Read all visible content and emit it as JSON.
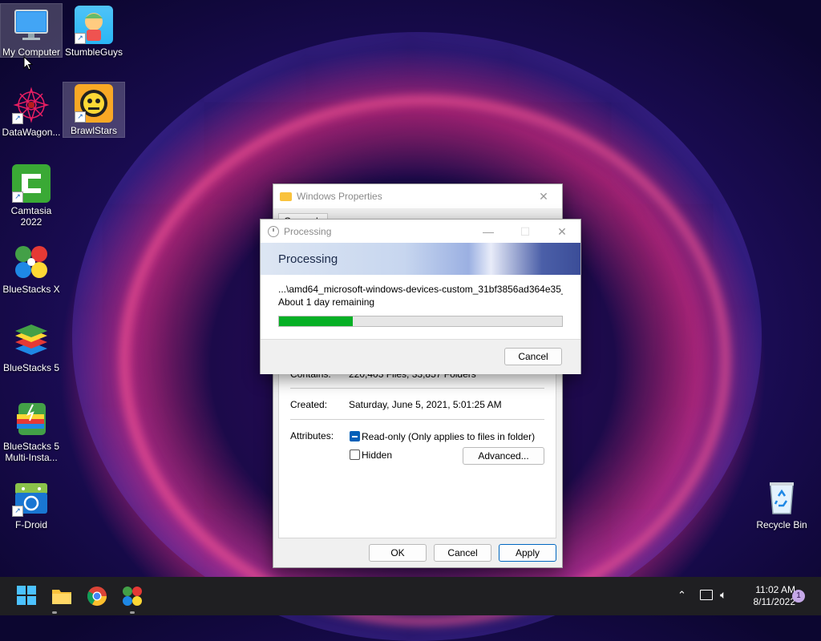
{
  "desktop": {
    "icons": [
      {
        "label": "My Computer",
        "icon": "monitor-icon"
      },
      {
        "label": "StumbleGuys",
        "icon": "stumbleguys-icon"
      },
      {
        "label": "DataWagon...",
        "icon": "datawagon-icon"
      },
      {
        "label": "BrawlStars",
        "icon": "brawlstars-icon"
      },
      {
        "label": "Camtasia 2022",
        "icon": "camtasia-icon"
      },
      {
        "label": "BlueStacks X",
        "icon": "bluestacks-x-icon"
      },
      {
        "label": "BlueStacks 5",
        "icon": "bluestacks-5-icon"
      },
      {
        "label": "BlueStacks 5 Multi-Insta...",
        "icon": "bluestacks-multi-icon"
      },
      {
        "label": "F-Droid",
        "icon": "fdroid-icon"
      },
      {
        "label": "Recycle Bin",
        "icon": "recycle-bin-icon"
      }
    ]
  },
  "properties": {
    "title": "Windows Properties",
    "tab": "General",
    "contains_label": "Contains:",
    "contains_value": "220,403 Files, 33,857 Folders",
    "created_label": "Created:",
    "created_value": "Saturday, June 5, 2021, 5:01:25 AM",
    "attributes_label": "Attributes:",
    "readonly_label": "Read-only (Only applies to files in folder)",
    "hidden_label": "Hidden",
    "advanced_button": "Advanced...",
    "ok_button": "OK",
    "cancel_button": "Cancel",
    "apply_button": "Apply"
  },
  "processing": {
    "title": "Processing",
    "header": "Processing",
    "file_path": "...\\amd64_microsoft-windows-devices-custom_31bf3856ad364e35_",
    "time_remaining": "About 1 day remaining",
    "progress": 0.26,
    "cancel_button": "Cancel",
    "accent": "#06b025"
  },
  "taskbar": {
    "time": "11:02 AM",
    "date": "8/11/2022",
    "notification_count": "1"
  }
}
